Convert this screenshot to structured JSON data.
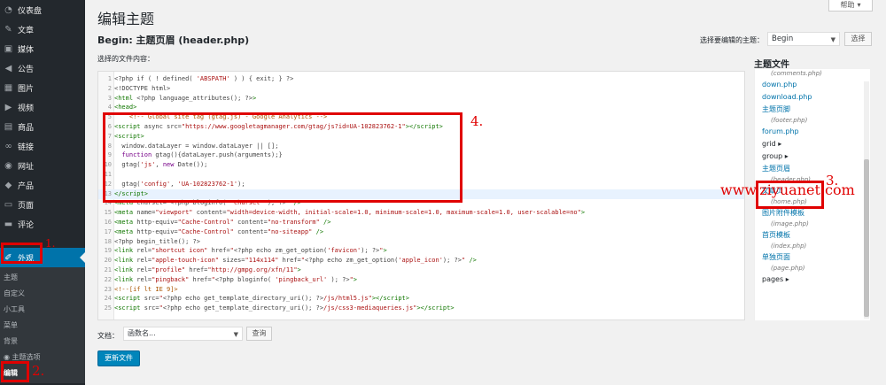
{
  "sidebar": {
    "items": [
      {
        "label": "仪表盘",
        "icon": "dashboard-icon",
        "glyph": "◔"
      },
      {
        "label": "文章",
        "icon": "pushpin-icon",
        "glyph": "✎"
      },
      {
        "label": "媒体",
        "icon": "media-icon",
        "glyph": "▣"
      },
      {
        "label": "公告",
        "icon": "megaphone-icon",
        "glyph": "◀"
      },
      {
        "label": "图片",
        "icon": "image-icon",
        "glyph": "▦"
      },
      {
        "label": "视频",
        "icon": "video-icon",
        "glyph": "▶"
      },
      {
        "label": "商品",
        "icon": "cart-icon",
        "glyph": "▤"
      },
      {
        "label": "链接",
        "icon": "link-icon",
        "glyph": "∞"
      },
      {
        "label": "网址",
        "icon": "globe-icon",
        "glyph": "◉"
      },
      {
        "label": "产品",
        "icon": "product-icon",
        "glyph": "◆"
      },
      {
        "label": "页面",
        "icon": "page-icon",
        "glyph": "▭"
      },
      {
        "label": "评论",
        "icon": "comment-icon",
        "glyph": "▬"
      }
    ],
    "active_item": {
      "label": "外观",
      "icon": "appearance-icon",
      "glyph": "✐"
    },
    "submenu": [
      "主题",
      "自定义",
      "小工具",
      "菜单",
      "背景",
      "主题选项",
      "编辑"
    ]
  },
  "header": {
    "title": "编辑主题",
    "help_label": "帮助",
    "file_heading": "Begin: 主题页眉 (header.php)",
    "select_theme_label": "选择要编辑的主题：",
    "selected_theme": "Begin",
    "select_button": "选择",
    "content_label": "选择的文件内容："
  },
  "editor": {
    "lines": [
      {
        "n": "1",
        "html": "&lt;?php if ( ! defined( <span class='str'>'ABSPATH'</span> ) ) { exit; } ?&gt;"
      },
      {
        "n": "2",
        "html": "&lt;!DOCTYPE html&gt;"
      },
      {
        "n": "3",
        "html": "<span class='tag'>&lt;html</span> &lt;?php language_attributes(); ?&gt;<span class='tag'>&gt;</span>"
      },
      {
        "n": "4",
        "html": "<span class='tag'>&lt;head&gt;</span>"
      },
      {
        "n": "5",
        "html": "    <span class='com'>&lt;!-- Global site tag (gtag.js) - Google Analytics --&gt;</span>"
      },
      {
        "n": "6",
        "html": "<span class='tag'>&lt;script</span> async src=<span class='str'>\"https://www.googletagmanager.com/gtag/js?id=UA-102823762-1\"</span><span class='tag'>&gt;&lt;/script&gt;</span>"
      },
      {
        "n": "7",
        "html": "<span class='tag'>&lt;script&gt;</span>"
      },
      {
        "n": "8",
        "html": "  window.dataLayer = window.dataLayer || [];"
      },
      {
        "n": "9",
        "html": "  <span class='kw'>function</span> gtag(){dataLayer.push(arguments);}"
      },
      {
        "n": "10",
        "html": "  gtag(<span class='str'>'js'</span>, <span class='kw'>new</span> Date());"
      },
      {
        "n": "11",
        "html": ""
      },
      {
        "n": "12",
        "html": "  gtag(<span class='str'>'config'</span>, <span class='str'>'UA-102823762-1'</span>);"
      },
      {
        "n": "13",
        "html": "<span class='tag'>&lt;/script&gt;</span>"
      },
      {
        "n": "14",
        "html": "<span class='tag'>&lt;meta</span> charset=<span class='str'>\"</span>&lt;?php bloginfo( <span class='str'>'charset'</span> ); ?&gt;<span class='str'>\"</span> <span class='tag'>/&gt;</span>"
      },
      {
        "n": "15",
        "html": "<span class='tag'>&lt;meta</span> name=<span class='str'>\"viewport\"</span> content=<span class='str'>\"width=device-width, initial-scale=1.0, minimum-scale=1.0, maximum-scale=1.0, user-scalable=no\"</span><span class='tag'>&gt;</span>"
      },
      {
        "n": "16",
        "html": "<span class='tag'>&lt;meta</span> http-equiv=<span class='str'>\"Cache-Control\"</span> content=<span class='str'>\"no-transform\"</span> <span class='tag'>/&gt;</span>"
      },
      {
        "n": "17",
        "html": "<span class='tag'>&lt;meta</span> http-equiv=<span class='str'>\"Cache-Control\"</span> content=<span class='str'>\"no-siteapp\"</span> <span class='tag'>/&gt;</span>"
      },
      {
        "n": "18",
        "html": "&lt;?php begin_title(); ?&gt;"
      },
      {
        "n": "19",
        "html": "<span class='tag'>&lt;link</span> rel=<span class='str'>\"shortcut icon\"</span> href=<span class='str'>\"</span>&lt;?php echo zm_get_option(<span class='str'>'favicon'</span>); ?&gt;<span class='str'>\"</span><span class='tag'>&gt;</span>"
      },
      {
        "n": "20",
        "html": "<span class='tag'>&lt;link</span> rel=<span class='str'>\"apple-touch-icon\"</span> sizes=<span class='str'>\"114x114\"</span> href=<span class='str'>\"</span>&lt;?php echo zm_get_option(<span class='str'>'apple_icon'</span>); ?&gt;<span class='str'>\"</span> <span class='tag'>/&gt;</span>"
      },
      {
        "n": "21",
        "html": "<span class='tag'>&lt;link</span> rel=<span class='str'>\"profile\"</span> href=<span class='str'>\"http://gmpg.org/xfn/11\"</span><span class='tag'>&gt;</span>"
      },
      {
        "n": "22",
        "html": "<span class='tag'>&lt;link</span> rel=<span class='str'>\"pingback\"</span> href=<span class='str'>\"</span>&lt;?php bloginfo( <span class='str'>'pingback_url'</span> ); ?&gt;<span class='str'>\"</span><span class='tag'>&gt;</span>"
      },
      {
        "n": "23",
        "html": "<span class='com'>&lt;!--[if lt IE 9]&gt;</span>"
      },
      {
        "n": "24",
        "html": "<span class='tag'>&lt;script</span> src=<span class='str'>\"</span>&lt;?php echo get_template_directory_uri(); ?&gt;<span class='str'>/js/html5.js\"</span><span class='tag'>&gt;&lt;/script&gt;</span>"
      },
      {
        "n": "25",
        "html": "<span class='tag'>&lt;script</span> src=<span class='str'>\"</span>&lt;?php echo get_template_directory_uri(); ?&gt;<span class='str'>/js/css3-mediaqueries.js\"</span><span class='tag'>&gt;&lt;/script&gt;</span>"
      }
    ],
    "highlight_line": "13"
  },
  "files": {
    "title": "主题文件",
    "items": [
      {
        "label": "(comments.php)",
        "kind": "sub"
      },
      {
        "label": "down.php",
        "kind": "link"
      },
      {
        "label": "download.php",
        "kind": "link"
      },
      {
        "label": "主题页脚",
        "kind": "link"
      },
      {
        "label": "(footer.php)",
        "kind": "sub"
      },
      {
        "label": "forum.php",
        "kind": "link"
      },
      {
        "label": "grid ▸",
        "kind": "folder"
      },
      {
        "label": "group ▸",
        "kind": "folder"
      },
      {
        "label": "主题页眉",
        "kind": "link"
      },
      {
        "label": "(header.php)",
        "kind": "sub"
      },
      {
        "label": "文章页",
        "kind": "link"
      },
      {
        "label": "(home.php)",
        "kind": "sub"
      },
      {
        "label": "图片附件模板",
        "kind": "link"
      },
      {
        "label": "(image.php)",
        "kind": "sub"
      },
      {
        "label": "首页模板",
        "kind": "link"
      },
      {
        "label": "(index.php)",
        "kind": "sub"
      },
      {
        "label": "单独页面",
        "kind": "link"
      },
      {
        "label": "(page.php)",
        "kind": "sub"
      },
      {
        "label": "pages ▸",
        "kind": "folder"
      }
    ]
  },
  "bottom": {
    "doc_label": "文档：",
    "func_placeholder": "函数名...",
    "lookup_button": "查询",
    "update_button": "更新文件"
  },
  "annotations": {
    "n1": "1.",
    "n2": "2.",
    "n3": "3.",
    "n4": "4.",
    "watermark": "www.ziyuanet.com"
  },
  "colors": {
    "sidebar_bg": "#23282d",
    "accent": "#0073aa",
    "annotation": "#e00000"
  }
}
